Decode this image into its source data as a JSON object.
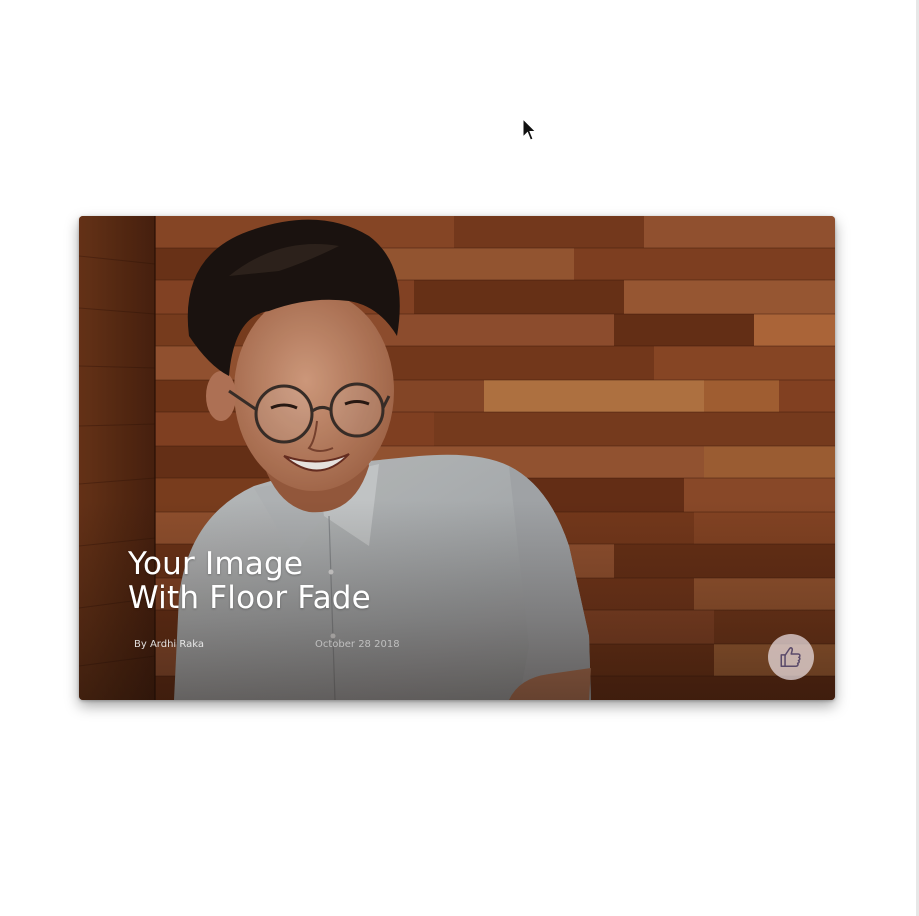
{
  "card": {
    "title_line1": "Your Image",
    "title_line2": "With Floor Fade",
    "author": "By Ardhi Raka",
    "date": "October 28 2018",
    "like_icon": "thumbs-up-icon"
  },
  "colors": {
    "background": "#ffffff",
    "title_text": "#ffffff",
    "like_button_bg": "#ebe1e4",
    "like_icon_stroke": "#5a4a6a",
    "wood_dark": "#5a2b15",
    "wood_mid": "#8a4a28",
    "wood_light": "#b06a3a"
  }
}
